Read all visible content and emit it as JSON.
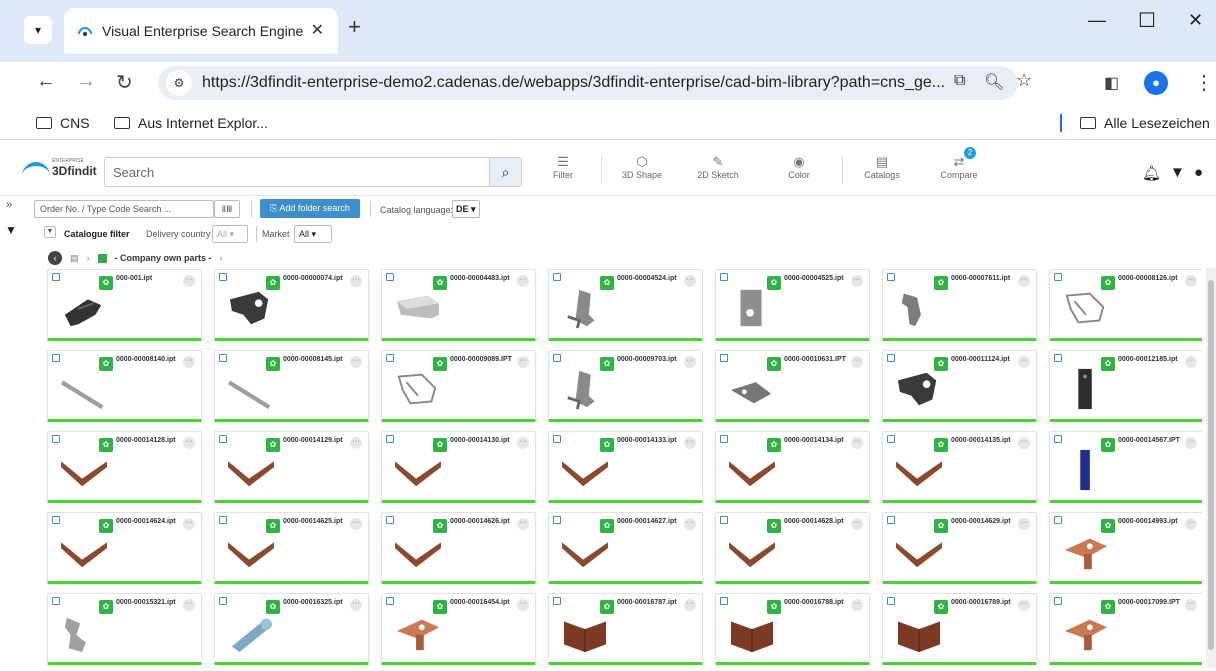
{
  "browser": {
    "tab_title": "Visual Enterprise Search Engine",
    "url": "https://3dfindit-enterprise-demo2.cadenas.de/webapps/3dfindit-enterprise/cad-bim-library?path=cns_ge...",
    "bookmarks": [
      "CNS",
      "Aus Internet Explor..."
    ],
    "all_bookmarks": "Alle Lesezeichen",
    "profile_initial": "👤"
  },
  "app": {
    "logo_small": "ENTERPRISE",
    "logo_main": "3Dfindit",
    "search_placeholder": "Search",
    "tools": [
      {
        "label": "Filter",
        "icon": "filter-sliders-icon"
      },
      {
        "label": "3D Shape",
        "icon": "cube-icon"
      },
      {
        "label": "2D Sketch",
        "icon": "pencil-icon"
      },
      {
        "label": "Color",
        "icon": "palette-icon"
      },
      {
        "label": "Catalogs",
        "icon": "catalog-icon"
      },
      {
        "label": "Compare",
        "icon": "compare-icon"
      }
    ],
    "compare_count": "2"
  },
  "toolbar": {
    "order_placeholder": "Order No. / Type Code Search ...",
    "barcode": "ⅡⅢ",
    "add_folder": "Add folder search",
    "catalog_language_label": "Catalog language:",
    "catalog_language_value": "DE ▾",
    "catalogue_filter": "Catalogue filter",
    "delivery_country_label": "Delivery country",
    "delivery_country_value": "All ▾",
    "market_label": "Market",
    "market_value": "All ▾"
  },
  "breadcrumb": {
    "current": "- Company own parts -"
  },
  "parts": [
    {
      "name": "000-001.ipt",
      "shape": "clip-dark"
    },
    {
      "name": "0000-00000074.ipt",
      "shape": "bracket-dark"
    },
    {
      "name": "0000-00004483.ipt",
      "shape": "bar-grey"
    },
    {
      "name": "0000-00004524.ipt",
      "shape": "hook-grey"
    },
    {
      "name": "0000-00004525.ipt",
      "shape": "block-grey"
    },
    {
      "name": "0000-00007611.ipt",
      "shape": "angle-grey"
    },
    {
      "name": "0000-00008126.ipt",
      "shape": "wire-grey"
    },
    {
      "name": "0000-00008140.ipt",
      "shape": "rail-grey"
    },
    {
      "name": "0000-00008145.ipt",
      "shape": "rail-grey"
    },
    {
      "name": "0000-00009089.IPT",
      "shape": "wire-grey"
    },
    {
      "name": "0000-00009703.ipt",
      "shape": "hook-grey"
    },
    {
      "name": "0000-00010631.IPT",
      "shape": "plate-grey"
    },
    {
      "name": "0000-00011124.ipt",
      "shape": "bracket-dark"
    },
    {
      "name": "0000-00012185.ipt",
      "shape": "post-dark"
    },
    {
      "name": "0000-00014128.ipt",
      "shape": "v-copper"
    },
    {
      "name": "0000-00014129.ipt",
      "shape": "v-copper"
    },
    {
      "name": "0000-00014130.ipt",
      "shape": "v-copper"
    },
    {
      "name": "0000-00014133.ipt",
      "shape": "v-copper"
    },
    {
      "name": "0000-00014134.ipt",
      "shape": "v-copper"
    },
    {
      "name": "0000-00014135.ipt",
      "shape": "v-copper"
    },
    {
      "name": "0000-00014567.IPT",
      "shape": "post-blue"
    },
    {
      "name": "0000-00014624.ipt",
      "shape": "v-copper"
    },
    {
      "name": "0000-00014625.ipt",
      "shape": "v-copper"
    },
    {
      "name": "0000-00014626.ipt",
      "shape": "v-copper"
    },
    {
      "name": "0000-00014627.ipt",
      "shape": "v-copper"
    },
    {
      "name": "0000-00014628.ipt",
      "shape": "v-copper"
    },
    {
      "name": "0000-00014629.ipt",
      "shape": "v-copper"
    },
    {
      "name": "0000-00014993.ipt",
      "shape": "lug-copper"
    },
    {
      "name": "0000-00015321.ipt",
      "shape": "clip-grey"
    },
    {
      "name": "0000-00016325.ipt",
      "shape": "pin-grey"
    },
    {
      "name": "0000-00016454.ipt",
      "shape": "lug-copper"
    },
    {
      "name": "0000-00016787.ipt",
      "shape": "angle-copper"
    },
    {
      "name": "0000-00016788.ipt",
      "shape": "angle-copper"
    },
    {
      "name": "0000-00016789.ipt",
      "shape": "angle-copper"
    },
    {
      "name": "0000-00017099.IPT",
      "shape": "lug-copper"
    }
  ],
  "colors": {
    "accent": "#3c8fcb",
    "card_bar": "#4cd137",
    "green_icon": "#2fb344"
  }
}
